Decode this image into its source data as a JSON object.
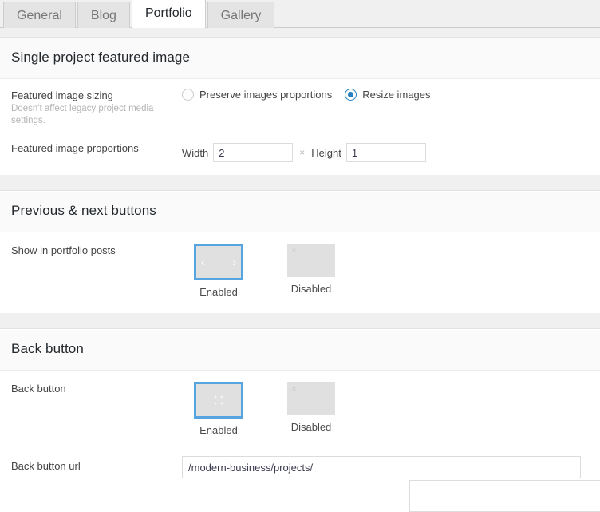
{
  "tabs": [
    {
      "label": "General",
      "active": false
    },
    {
      "label": "Blog",
      "active": false
    },
    {
      "label": "Portfolio",
      "active": true
    },
    {
      "label": "Gallery",
      "active": false
    }
  ],
  "colors": {
    "accent_blue": "#2580c2",
    "selection_border": "#56a4e0",
    "tile_gray": "#e0e0e0",
    "section_header_bg": "#fafafa",
    "page_gap_bg": "#f0f0f0"
  },
  "sections": [
    {
      "title": "Single project featured image",
      "rows": [
        {
          "label": "Featured image sizing",
          "sublabel": "Doesn't affect legacy project media settings.",
          "type": "radio",
          "options": [
            {
              "label": "Preserve images proportions",
              "checked": false
            },
            {
              "label": "Resize images",
              "checked": true
            }
          ]
        },
        {
          "label": "Featured image proportions",
          "type": "proportions",
          "width_label": "Width",
          "width_value": "2",
          "separator": "×",
          "height_label": "Height",
          "height_value": "1"
        }
      ]
    },
    {
      "title": "Previous & next buttons",
      "rows": [
        {
          "label": "Show in portfolio posts",
          "type": "tiles",
          "tiles": [
            {
              "caption": "Enabled",
              "selected": true,
              "icon": "prev-next-chevrons-icon"
            },
            {
              "caption": "Disabled",
              "selected": false,
              "icon": "disabled-x-icon"
            }
          ]
        }
      ]
    },
    {
      "title": "Back button",
      "rows": [
        {
          "label": "Back button",
          "type": "tiles",
          "tiles": [
            {
              "caption": "Enabled",
              "selected": true,
              "icon": "grid-dots-icon"
            },
            {
              "caption": "Disabled",
              "selected": false,
              "icon": "disabled-x-icon"
            }
          ]
        },
        {
          "label": "Back button url",
          "type": "url",
          "value": "/modern-business/projects/"
        }
      ]
    }
  ],
  "icons": {
    "chevron_left": "‹",
    "chevron_right": "›",
    "close_x": "×"
  }
}
